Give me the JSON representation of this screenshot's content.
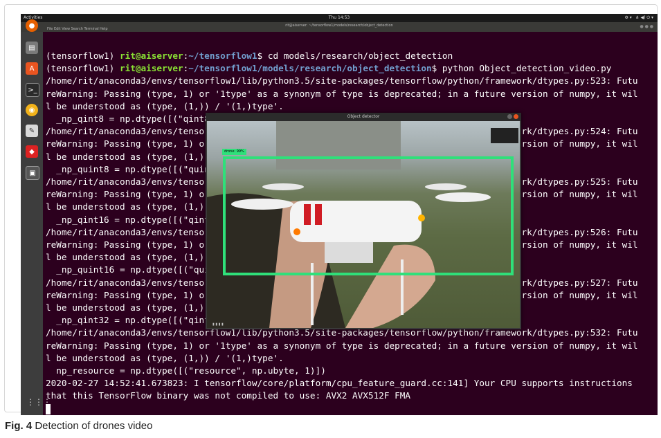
{
  "topbar": {
    "activities": "Activities",
    "clock": "Thu 14:53"
  },
  "terminal": {
    "title": "rit@aiserver: ~/tensorflow1/models/research/object_detection",
    "menus": "File  Edit  View  Search  Terminal  Help",
    "prompt_env": "(tensorflow1) ",
    "prompt_user": "rit@aiserver",
    "path1": "~/tensorflow1",
    "cmd1": "$ cd models/research/object_detection",
    "path2": "~/tensorflow1/models/research/object_detection",
    "cmd2": "$ python Object_detection_video.py",
    "lines": [
      "/home/rit/anaconda3/envs/tensorflow1/lib/python3.5/site-packages/tensorflow/python/framework/dtypes.py:523: Futu",
      "reWarning: Passing (type, 1) or '1type' as a synonym of type is deprecated; in a future version of numpy, it wil",
      "l be understood as (type, (1,)) / '(1,)type'.",
      "  _np_qint8 = np.dtype([(\"qint8\", np.int8, 1)])",
      "/home/rit/anaconda3/envs/tensorflow1/lib/python3.5/site-packages/tensorflow/python/framework/dtypes.py:524: Futu",
      "reWarning: Passing (type, 1) or '1type' as a synonym of type is deprecated; in a future version of numpy, it wil",
      "l be understood as (type, (1,)) / '(1,)type'.",
      "  _np_quint8 = np.dtype([(\"quint8\", np.uint8, 1)])",
      "/home/rit/anaconda3/envs/tensorflow1/lib/python3.5/site-packages/tensorflow/python/framework/dtypes.py:525: Futu",
      "reWarning: Passing (type, 1) or '1type' as a synonym of type is deprecated; in a future version of numpy, it wil",
      "l be understood as (type, (1,)) / '(1,)type'.",
      "  _np_qint16 = np.dtype([(\"qint16\", np.int16, 1)])",
      "/home/rit/anaconda3/envs/tensorflow1/lib/python3.5/site-packages/tensorflow/python/framework/dtypes.py:526: Futu",
      "reWarning: Passing (type, 1) or '1type' as a synonym of type is deprecated; in a future version of numpy, it wil",
      "l be understood as (type, (1,)) / '(1,)type'.",
      "  _np_quint16 = np.dtype([(\"quint16\", np.uint16, 1)])",
      "/home/rit/anaconda3/envs/tensorflow1/lib/python3.5/site-packages/tensorflow/python/framework/dtypes.py:527: Futu",
      "reWarning: Passing (type, 1) or '1type' as a synonym of type is deprecated; in a future version of numpy, it wil",
      "l be understood as (type, (1,)) / '(1,)type'.",
      "  _np_qint32 = np.dtype([(\"qint32\", np.int32, 1)])",
      "/home/rit/anaconda3/envs/tensorflow1/lib/python3.5/site-packages/tensorflow/python/framework/dtypes.py:532: Futu",
      "reWarning: Passing (type, 1) or '1type' as a synonym of type is deprecated; in a future version of numpy, it wil",
      "l be understood as (type, (1,)) / '(1,)type'.",
      "  np_resource = np.dtype([(\"resource\", np.ubyte, 1)])",
      "2020-02-27 14:52:41.673823: I tensorflow/core/platform/cpu_feature_guard.cc:141] Your CPU supports instructions",
      "that this TensorFlow binary was not compiled to use: AVX2 AVX512F FMA"
    ]
  },
  "detector": {
    "title": "Object detector",
    "label": "drone: 99%"
  },
  "caption": {
    "fig": "Fig. 4",
    "text": " Detection of drones video"
  },
  "colors": {
    "terminal_bg": "#2c001e",
    "prompt_green": "#8ae234",
    "path_blue": "#729fcf",
    "bbox_green": "#2fe07a"
  }
}
